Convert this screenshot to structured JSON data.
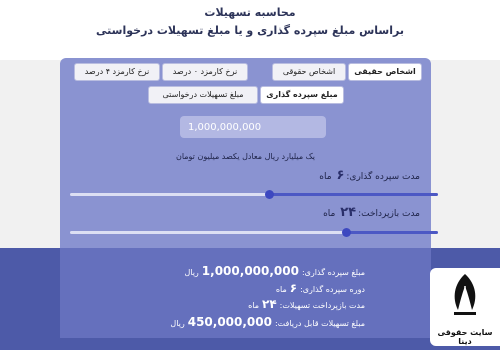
{
  "header": {
    "title": "محاسبه تسهیلات",
    "subtitle": "براساس مبلغ سپرده گذاری و یا مبلغ تسهیلات درخواستی"
  },
  "person_tabs": {
    "real": "اشخاص حقیقی",
    "legal": "اشخاص حقوقی",
    "selected": "real"
  },
  "rate_tabs": {
    "zero": "نرخ کارمزد ۰ درصد",
    "four": "نرخ کارمزد ۴ درصد"
  },
  "basis_tabs": {
    "deposit": "مبلغ سپرده گذاری",
    "requested": "مبلغ تسهیلات درخواستی",
    "selected": "deposit"
  },
  "amount": {
    "value": "1,000,000,000",
    "hint": "یک میلیارد ریال معادل یکصد میلیون تومان"
  },
  "deposit_period": {
    "label": "مدت سپرده گذاری:",
    "value": "۶",
    "unit": "ماه",
    "level_percent": 54
  },
  "repay_period": {
    "label": "مدت بازپرداخت:",
    "value": "۲۴",
    "unit": "ماه",
    "level_percent": 75
  },
  "results": {
    "deposit_amount_label": "مبلغ سپرده گذاری:",
    "deposit_amount_value": "1,000,000,000",
    "deposit_amount_unit": "ریال",
    "deposit_period_label": "دوره سپرده گذاری:",
    "deposit_period_value": "۶",
    "deposit_period_unit": "ماه",
    "repay_label": "مدت بازپرداخت تسهیلات:",
    "repay_value": "۲۴",
    "repay_unit": "ماه",
    "loan_label": "مبلغ تسهیلات قابل دریافت:",
    "loan_value": "450,000,000",
    "loan_unit": "ریال"
  },
  "logo": {
    "text": "سایت حقوقی دینا"
  },
  "colors": {
    "accent": "#4c58c4",
    "panel": "#8a93d1",
    "results_bg": "#4d5aa8"
  }
}
